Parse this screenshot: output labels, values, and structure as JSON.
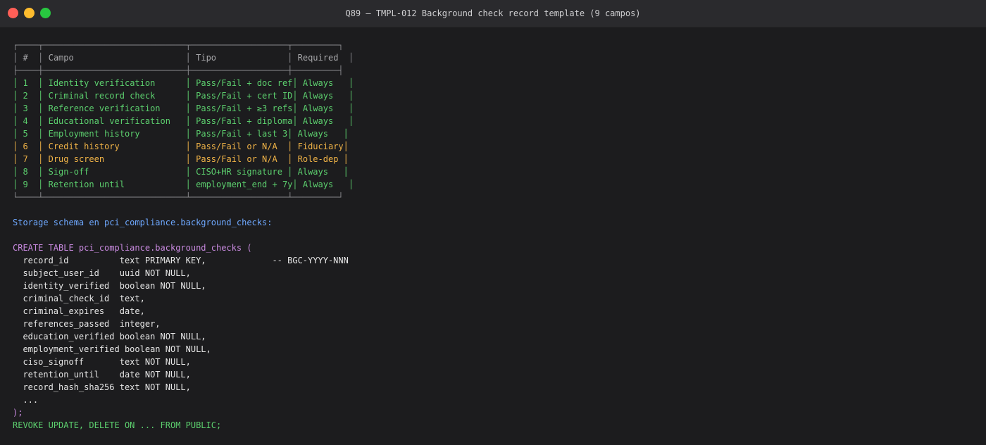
{
  "window": {
    "title": "Q89 — TMPL-012 Background check record template (9 campos)"
  },
  "table": {
    "headers": [
      "#",
      "Campo",
      "Tipo",
      "Required"
    ],
    "rows": [
      {
        "n": "1",
        "campo": "Identity verification",
        "tipo": "Pass/Fail + doc ref",
        "req": "Always",
        "highlight": false
      },
      {
        "n": "2",
        "campo": "Criminal record check",
        "tipo": "Pass/Fail + cert ID",
        "req": "Always",
        "highlight": false
      },
      {
        "n": "3",
        "campo": "Reference verification",
        "tipo": "Pass/Fail + ≥3 refs",
        "req": "Always",
        "highlight": false
      },
      {
        "n": "4",
        "campo": "Educational verification",
        "tipo": "Pass/Fail + diploma",
        "req": "Always",
        "highlight": false
      },
      {
        "n": "5",
        "campo": "Employment history",
        "tipo": "Pass/Fail + last 3",
        "req": "Always",
        "highlight": false
      },
      {
        "n": "6",
        "campo": "Credit history",
        "tipo": "Pass/Fail or N/A",
        "req": "Fiduciary",
        "highlight": true
      },
      {
        "n": "7",
        "campo": "Drug screen",
        "tipo": "Pass/Fail or N/A",
        "req": "Role-dep",
        "highlight": true
      },
      {
        "n": "8",
        "campo": "Sign-off",
        "tipo": "CISO+HR signature",
        "req": "Always",
        "highlight": false
      },
      {
        "n": "9",
        "campo": "Retention until",
        "tipo": "employment_end + 7y",
        "req": "Always",
        "highlight": false
      }
    ]
  },
  "storage_label": "Storage schema en pci_compliance.background_checks:",
  "sql": {
    "create": "CREATE TABLE pci_compliance.background_checks (",
    "columns": [
      "  record_id          text PRIMARY KEY,             -- BGC-YYYY-NNN",
      "  subject_user_id    uuid NOT NULL,",
      "  identity_verified  boolean NOT NULL,",
      "  criminal_check_id  text,",
      "  criminal_expires   date,",
      "  references_passed  integer,",
      "  education_verified boolean NOT NULL,",
      "  employment_verified boolean NOT NULL,",
      "  ciso_signoff       text NOT NULL,",
      "  retention_until    date NOT NULL,",
      "  record_hash_sha256 text NOT NULL,",
      "  ..."
    ],
    "close": ");",
    "revoke": "REVOKE UPDATE, DELETE ON ... FROM PUBLIC;"
  },
  "colors": {
    "green": "#5ccf6e",
    "orange": "#f0b347",
    "blue": "#6ea8ff",
    "purple": "#c98ae0"
  }
}
